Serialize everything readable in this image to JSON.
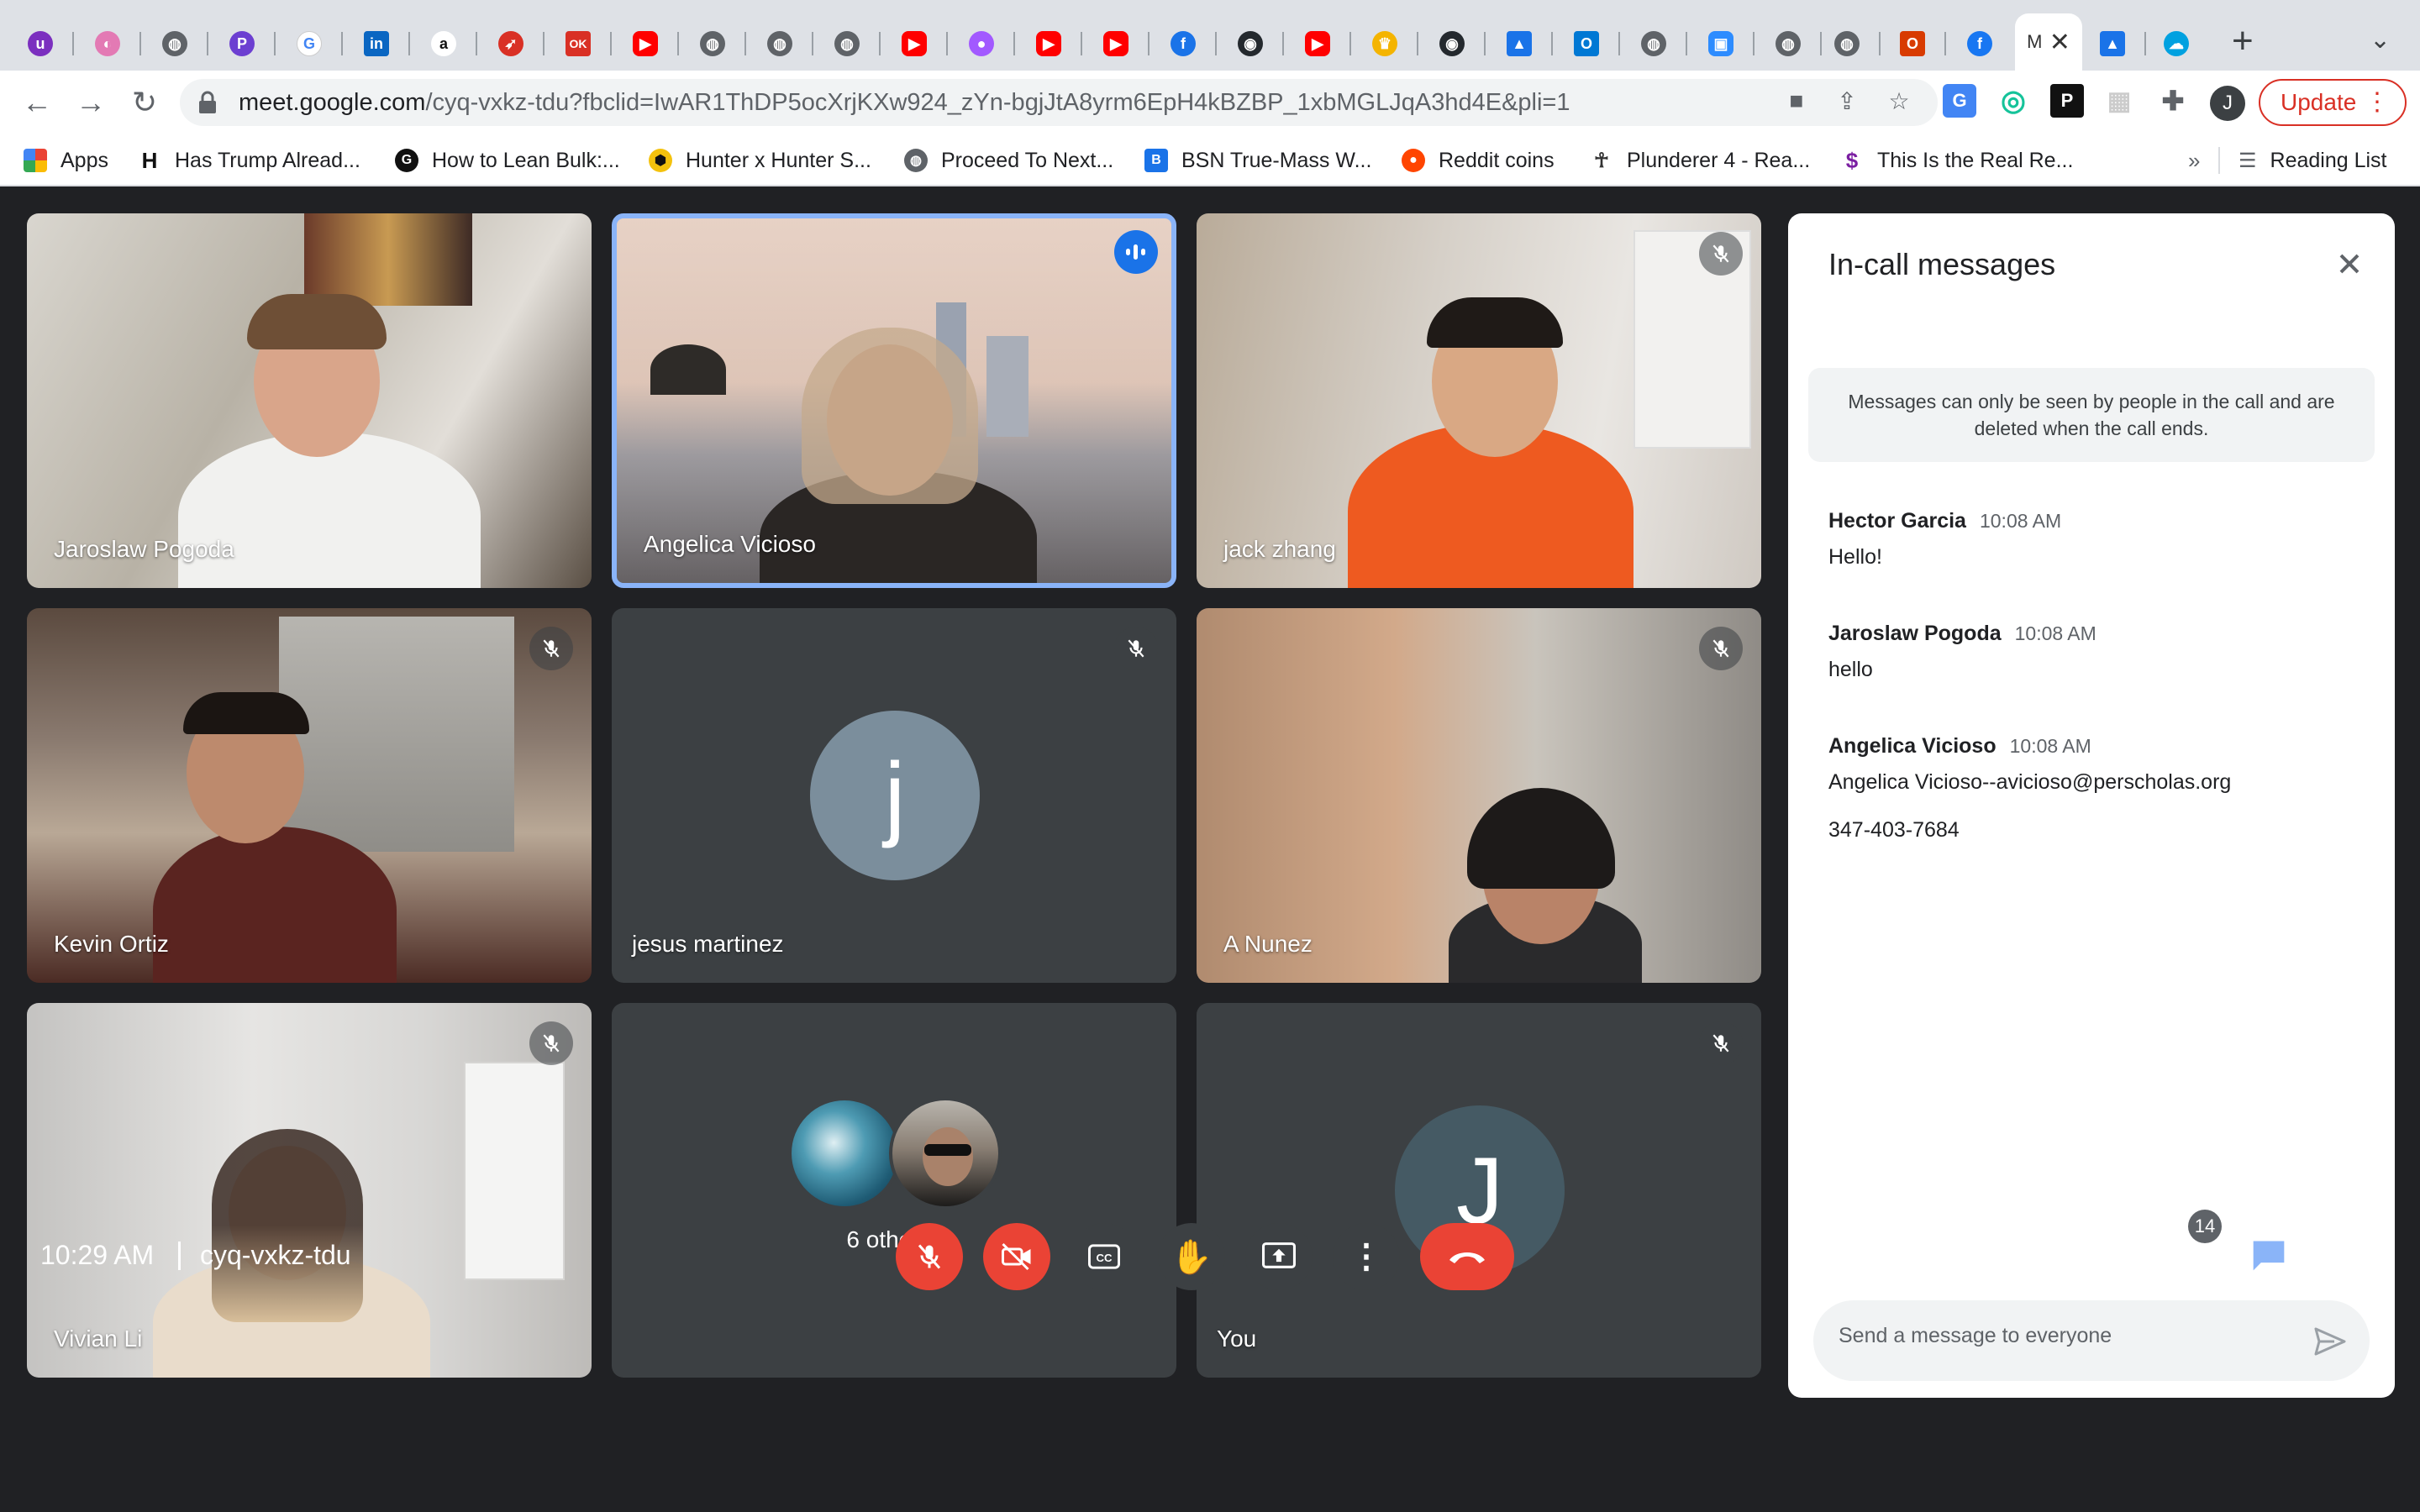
{
  "browser": {
    "tabs_favicons": [
      "u",
      "p",
      "globe",
      "P",
      "G",
      "in",
      "a",
      "arrow",
      "OK",
      "yt",
      "globe",
      "globe",
      "globe",
      "yt",
      "circle",
      "yt",
      "yt",
      "f",
      "gh",
      "yt",
      "crown",
      "gh",
      "cap",
      "outlook",
      "globe",
      "zoom",
      "globe",
      "globe",
      "office",
      "fb"
    ],
    "active_tab_label": "M",
    "url_host": "meet.google.com",
    "url_rest": "/cyq-vxkz-tdu?fbclid=IwAR1ThDP5ocXrjKXw924_zYn-bgjJtA8yrm6EpH4kBZBP_1xbMGLJqA3hd4E&pli=1",
    "profile_initial": "J",
    "update_label": "Update",
    "bookmarks": [
      {
        "label": "Apps"
      },
      {
        "label": "Has Trump Alread..."
      },
      {
        "label": "How to Lean Bulk:..."
      },
      {
        "label": "Hunter x Hunter S..."
      },
      {
        "label": "Proceed To Next..."
      },
      {
        "label": "BSN True-Mass W..."
      },
      {
        "label": "Reddit coins"
      },
      {
        "label": "Plunderer 4 - Rea..."
      },
      {
        "label": "This Is the Real Re..."
      }
    ],
    "bookmarks_overflow": "»",
    "reading_list": "Reading List"
  },
  "participants": [
    {
      "name": "Jaroslaw Pogoda"
    },
    {
      "name": "Angelica Vicioso"
    },
    {
      "name": "jack zhang"
    },
    {
      "name": "Kevin Ortiz"
    },
    {
      "name": "jesus martinez",
      "avatar_letter": "j"
    },
    {
      "name": "A Nunez"
    },
    {
      "name": "Vivian Li"
    },
    {
      "others_label": "6 others"
    },
    {
      "name": "You",
      "avatar_letter": "J"
    }
  ],
  "panel": {
    "title": "In-call messages",
    "note": "Messages can only be seen by people in the call and are deleted when the call ends.",
    "messages": [
      {
        "sender": "Hector Garcia",
        "time": "10:08 AM",
        "text": "Hello!"
      },
      {
        "sender": "Jaroslaw Pogoda",
        "time": "10:08 AM",
        "text": "hello"
      },
      {
        "sender": "Angelica Vicioso",
        "time": "10:08 AM",
        "text": "Angelica Vicioso--avicioso@perscholas.org",
        "text2": "347-403-7684"
      }
    ],
    "input_placeholder": "Send a message to everyone"
  },
  "bottom_bar": {
    "time": "10:29 AM",
    "meeting_code": "cyq-vxkz-tdu",
    "people_count": "14"
  },
  "colors": {
    "background": "#202124",
    "tile": "#3c4043",
    "danger": "#ea4335",
    "accent": "#8ab4f8",
    "chat_blue": "#8ab4f8"
  }
}
